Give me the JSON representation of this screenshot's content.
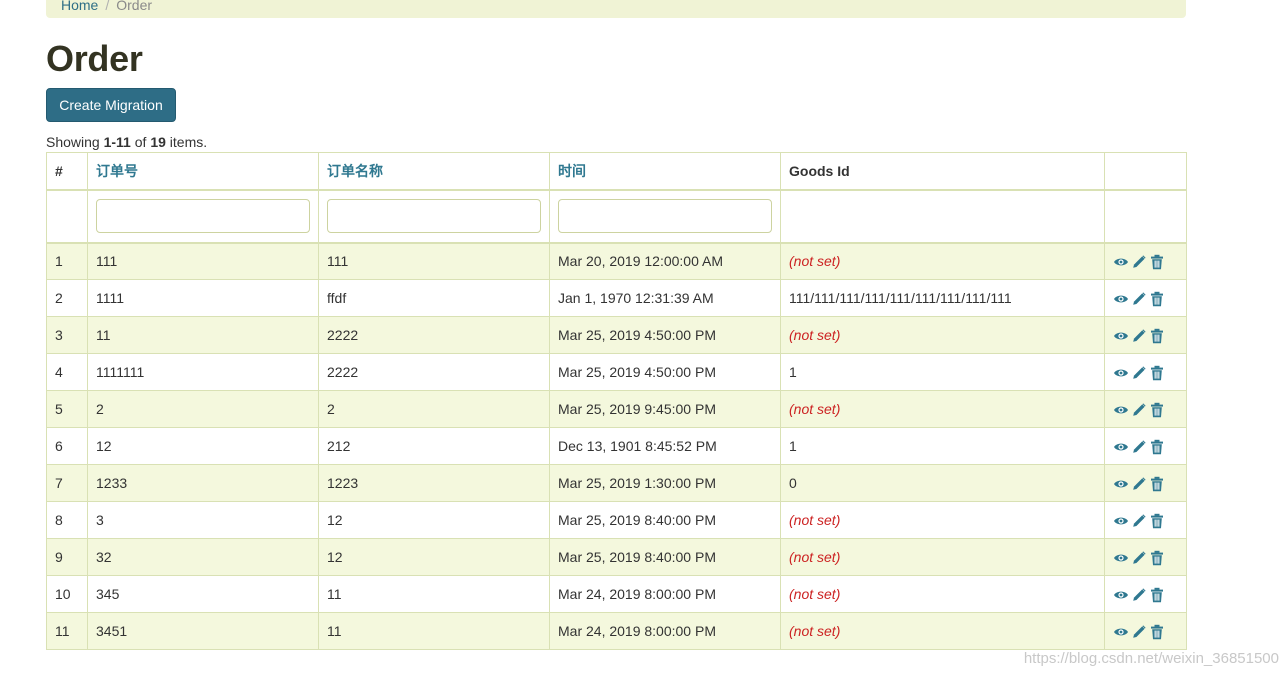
{
  "breadcrumb": {
    "home": "Home",
    "separator": "/",
    "current": "Order"
  },
  "page": {
    "title": "Order"
  },
  "toolbar": {
    "create_label": "Create Migration"
  },
  "summary": {
    "prefix": "Showing ",
    "range": "1-11",
    "middle": " of ",
    "total": "19",
    "suffix": " items."
  },
  "table": {
    "headers": {
      "index": "#",
      "order_no": "订单号",
      "order_name": "订单名称",
      "time": "时间",
      "goods_id": "Goods Id",
      "actions": ""
    },
    "filters": {
      "order_no": "",
      "order_name": "",
      "time": ""
    },
    "rows": [
      {
        "index": "1",
        "order_no": "111",
        "order_name": "111",
        "time": "Mar 20, 2019 12:00:00 AM",
        "goods_id": "(not set)"
      },
      {
        "index": "2",
        "order_no": "1111",
        "order_name": "ffdf",
        "time": "Jan 1, 1970 12:31:39 AM",
        "goods_id": "111/111/111/111/111/111/111/111/111"
      },
      {
        "index": "3",
        "order_no": "11",
        "order_name": "2222",
        "time": "Mar 25, 2019 4:50:00 PM",
        "goods_id": "(not set)"
      },
      {
        "index": "4",
        "order_no": "1111111",
        "order_name": "2222",
        "time": "Mar 25, 2019 4:50:00 PM",
        "goods_id": "1"
      },
      {
        "index": "5",
        "order_no": "2",
        "order_name": "2",
        "time": "Mar 25, 2019 9:45:00 PM",
        "goods_id": "(not set)"
      },
      {
        "index": "6",
        "order_no": "12",
        "order_name": "212",
        "time": "Dec 13, 1901 8:45:52 PM",
        "goods_id": "1"
      },
      {
        "index": "7",
        "order_no": "1233",
        "order_name": "1223",
        "time": "Mar 25, 2019 1:30:00 PM",
        "goods_id": "0"
      },
      {
        "index": "8",
        "order_no": "3",
        "order_name": "12",
        "time": "Mar 25, 2019 8:40:00 PM",
        "goods_id": "(not set)"
      },
      {
        "index": "9",
        "order_no": "32",
        "order_name": "12",
        "time": "Mar 25, 2019 8:40:00 PM",
        "goods_id": "(not set)"
      },
      {
        "index": "10",
        "order_no": "345",
        "order_name": "11",
        "time": "Mar 24, 2019 8:00:00 PM",
        "goods_id": "(not set)"
      },
      {
        "index": "11",
        "order_no": "3451",
        "order_name": "11",
        "time": "Mar 24, 2019 8:00:00 PM",
        "goods_id": "(not set)"
      }
    ],
    "row_actions": [
      "eye-icon",
      "pencil-icon",
      "trash-icon"
    ]
  },
  "watermark": "https://blog.csdn.net/weixin_36851500",
  "colors": {
    "accent": "#2e6d86",
    "link": "#2f7890",
    "striped_row": "#f4f8dd",
    "breadcrumb_bg": "#f0f3d5",
    "not_set": "#cc2222"
  }
}
